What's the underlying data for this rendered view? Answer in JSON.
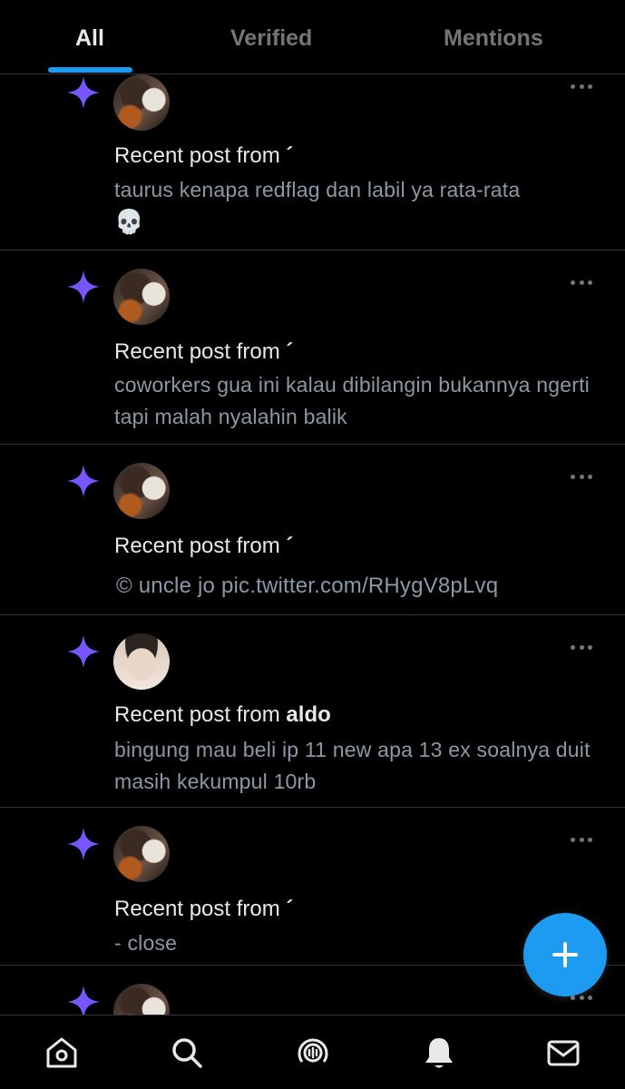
{
  "tabs": [
    {
      "label": "All",
      "active": true
    },
    {
      "label": "Verified",
      "active": false
    },
    {
      "label": "Mentions",
      "active": false
    }
  ],
  "notifications": [
    {
      "prefix": "Recent post from",
      "author": "´",
      "body": "taurus kenapa redflag dan labil ya rata-rata",
      "emoji": "💀"
    },
    {
      "prefix": "Recent post from",
      "author": "´",
      "body": "coworkers gua ini kalau dibilangin bukannya ngerti tapi malah nyalahin balik"
    },
    {
      "prefix": "Recent post from",
      "author": "´",
      "body": "© uncle jo pic.twitter.com/RHygV8pLvq"
    },
    {
      "prefix": "Recent post from",
      "author": "aldo",
      "body": "bingung mau beli ip 11 new apa 13 ex soalnya duit masih kekumpul 10rb"
    },
    {
      "prefix": "Recent post from",
      "author": "´",
      "body": "-  close"
    }
  ],
  "icons": {
    "sparkle": "sparkle-icon",
    "more": "more-icon",
    "fab": "plus-icon",
    "nav": [
      "home-icon",
      "search-icon",
      "spaces-icon",
      "notifications-icon",
      "messages-icon"
    ]
  },
  "colors": {
    "accent": "#1d9bf0",
    "sparkle": "#7856ff",
    "background": "#000000",
    "secondary_text": "#8b98a5"
  }
}
